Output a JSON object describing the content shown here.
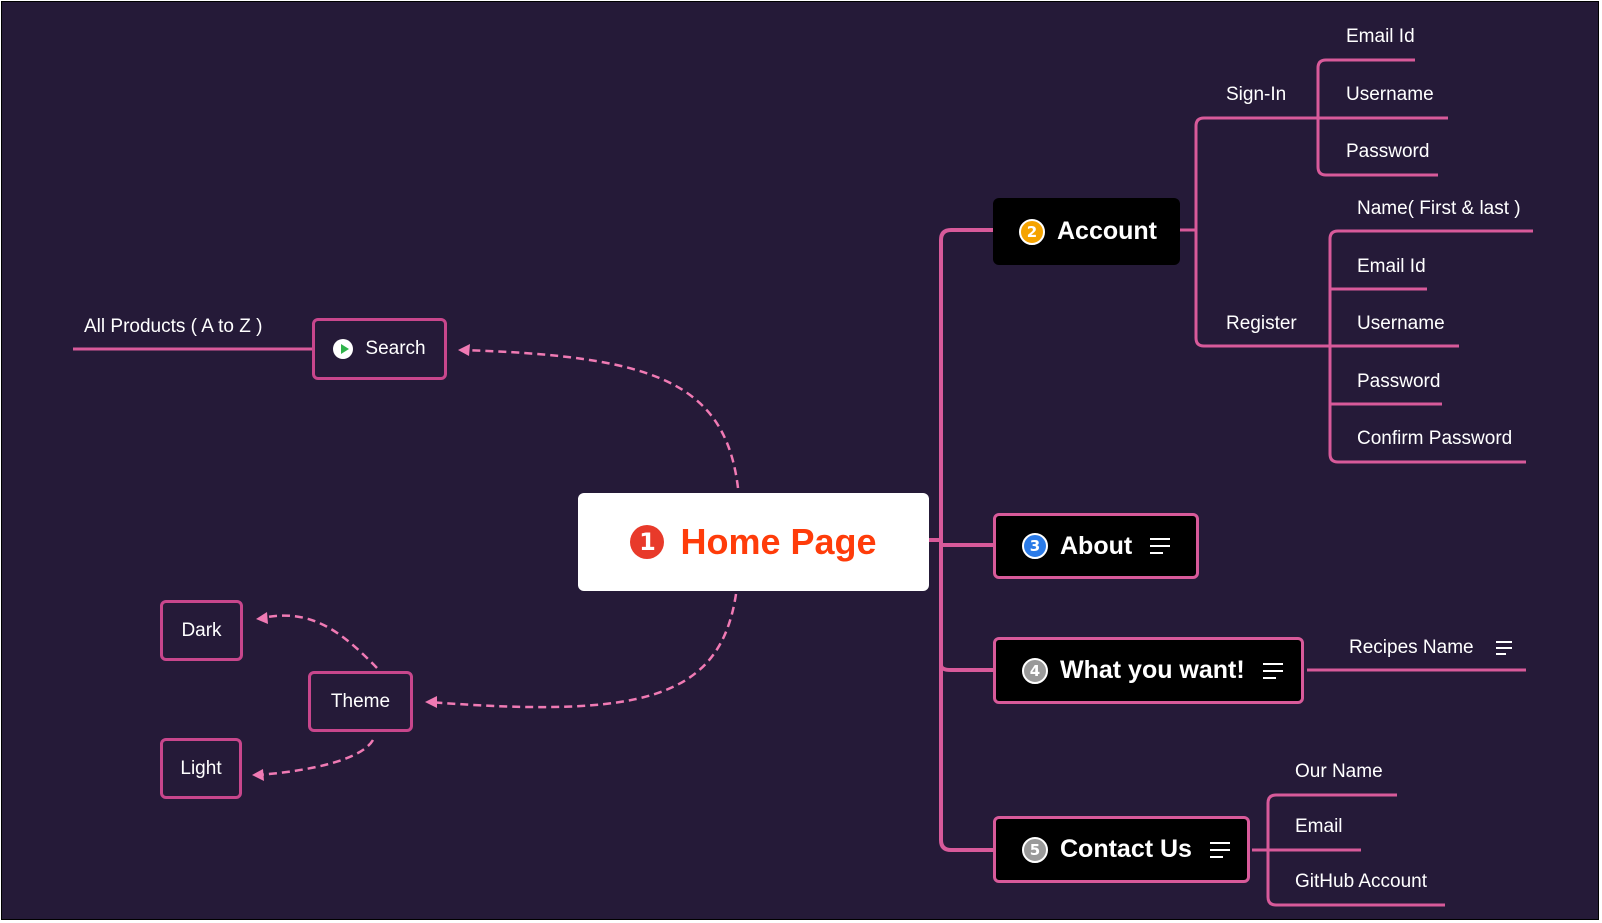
{
  "root": {
    "number": "1",
    "title": "Home Page"
  },
  "colors": {
    "background": "#251a38",
    "branch": "#d85a9a",
    "root_text": "#ff3c0a",
    "account_badge": "#f5a300",
    "about_badge": "#2b7be8",
    "gray_badge": "#9a9a9a"
  },
  "branches": {
    "account": {
      "number": "2",
      "title": "Account",
      "sign_in": {
        "label": "Sign-In",
        "items": [
          "Email Id",
          "Username",
          "Password"
        ]
      },
      "register": {
        "label": "Register",
        "items": [
          "Name( First & last )",
          "Email Id",
          "Username",
          "Password",
          "Confirm Password"
        ]
      }
    },
    "about": {
      "number": "3",
      "title": "About",
      "icon": "notes-icon"
    },
    "want": {
      "number": "4",
      "title": "What you want!",
      "icon": "notes-icon",
      "child": {
        "label": "Recipes Name",
        "icon": "notes-icon"
      }
    },
    "contact": {
      "number": "5",
      "title": "Contact Us",
      "icon": "notes-icon",
      "items": [
        "Our Name",
        "Email",
        "GitHub Account"
      ]
    }
  },
  "search": {
    "label": "Search",
    "icon": "play-icon",
    "child": "All Products ( A to Z )"
  },
  "theme": {
    "label": "Theme",
    "options": [
      "Dark",
      "Light"
    ]
  }
}
